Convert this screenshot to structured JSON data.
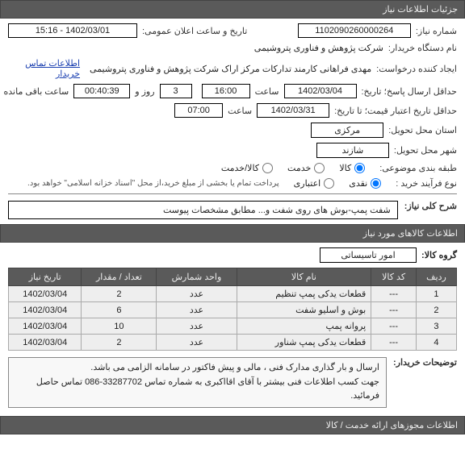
{
  "sections": {
    "details": "جزئیات اطلاعات نیاز",
    "items": "اطلاعات کالاهای مورد نیاز",
    "permits": "اطلاعات مجوزهای ارائه خدمت / کالا"
  },
  "labels": {
    "need_number": "شماره نیاز:",
    "announce_date": "تاریخ و ساعت اعلان عمومی:",
    "buyer_org": "نام دستگاه خریدار:",
    "creator": "ایجاد کننده درخواست:",
    "contact_link": "اطلاعات تماس خریدار",
    "answer_deadline": "حداقل ارسال پاسخ؛ تاریخ:",
    "hour": "ساعت",
    "day_and": "روز و",
    "remaining": "ساعت باقی مانده",
    "valid_deadline": "حداقل تاریخ اعتبار قیمت؛ تا تاریخ:",
    "delivery_province": "استان محل تحویل:",
    "delivery_city": "شهر محل تحویل:",
    "category": "طبقه بندی موضوعی:",
    "goods": "کالا",
    "service": "خدمت",
    "both": "کالا/خدمت",
    "process": "نوع فرآیند خرید :",
    "cash": "نقدی",
    "credit": "اعتباری",
    "credit_note": "پرداخت تمام یا بخشی از مبلغ خرید،از محل \"اسناد خزانه اسلامی\" خواهد بود.",
    "need_title": "شرح کلی نیاز:",
    "goods_group": "گروه کالا:",
    "buyer_notes": "توضیحات خریدار:",
    "col_row": "ردیف",
    "col_code": "کد کالا",
    "col_name": "نام کالا",
    "col_unit": "واحد شمارش",
    "col_qty": "تعداد / مقدار",
    "col_date": "تاریخ نیاز"
  },
  "values": {
    "need_number": "1102090260000264",
    "announce_date": "1402/03/01 - 15:16",
    "buyer_org": "شرکت پژوهش و فناوری پتروشیمی",
    "creator": "مهدی فراهانی کارمند تدارکات مرکز اراک شرکت پژوهش و فناوری پتروشیمی",
    "answer_date": "1402/03/04",
    "answer_hour": "16:00",
    "days_remaining": "3",
    "countdown": "00:40:39",
    "valid_date": "1402/03/31",
    "valid_hour": "07:00",
    "province": "مرکزی",
    "city": "شازند",
    "need_title": "شفت پمپ-بوش های روی شفت و... مطابق مشخصات پیوست",
    "goods_group": "امور تاسیساتی",
    "buyer_notes": "ارسال و بار گذاری مدارک فنی ، مالی و پیش فاکتور در سامانه الزامی می باشد.\nجهت کسب اطلاعات فنی بیشتر با آقای اقااکبری به شماره تماس 33287702-086 تماس حاصل فرمائید."
  },
  "category_selected": "goods",
  "process_selected": "cash",
  "table": [
    {
      "row": "1",
      "code": "---",
      "name": "قطعات یدکی پمپ تنظیم",
      "unit": "عدد",
      "qty": "2",
      "date": "1402/03/04"
    },
    {
      "row": "2",
      "code": "---",
      "name": "بوش و اسلیو شفت",
      "unit": "عدد",
      "qty": "6",
      "date": "1402/03/04"
    },
    {
      "row": "3",
      "code": "---",
      "name": "پروانه پمپ",
      "unit": "عدد",
      "qty": "10",
      "date": "1402/03/04"
    },
    {
      "row": "4",
      "code": "---",
      "name": "قطعات یدکی پمپ شناور",
      "unit": "عدد",
      "qty": "2",
      "date": "1402/03/04"
    }
  ]
}
